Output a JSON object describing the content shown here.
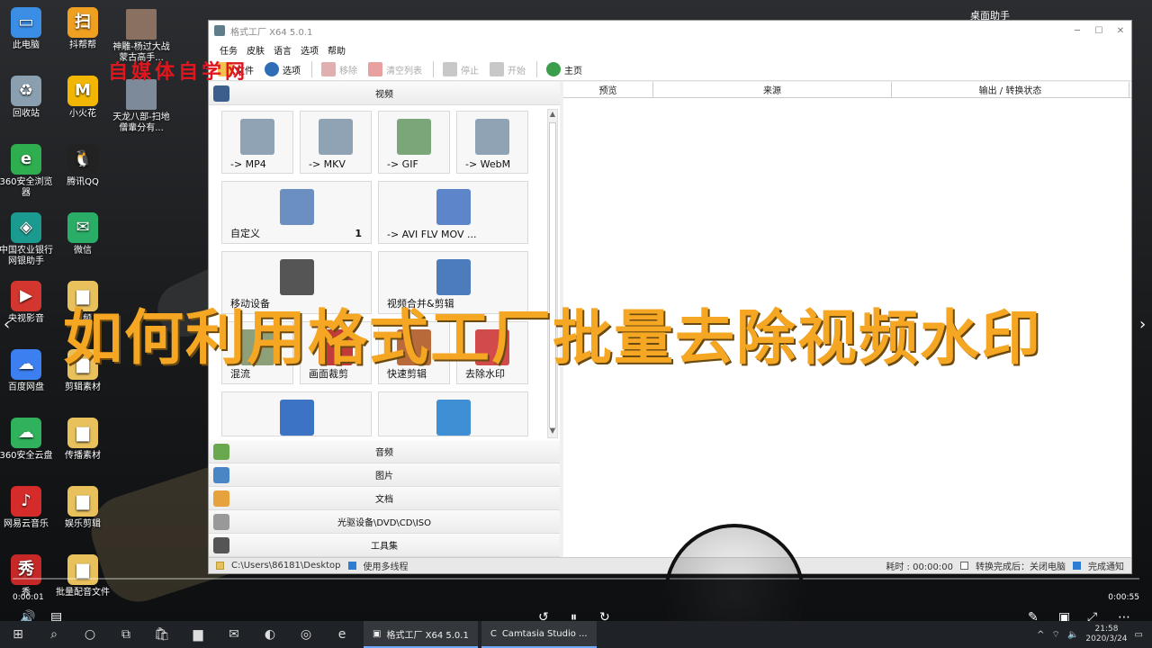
{
  "overlay_title": "如何利用格式工厂批量去除视频水印",
  "watermark_text": "自媒体自学网",
  "desktop_icons": [
    {
      "label": "此电脑",
      "color": "#3a8ee6",
      "glyph": "▭"
    },
    {
      "label": "回收站",
      "color": "#8aa0b0",
      "glyph": "♻"
    },
    {
      "label": "360安全浏览器",
      "color": "#2eae4f",
      "glyph": "e"
    },
    {
      "label": "中国农业银行网银助手",
      "color": "#1b9b8f",
      "glyph": "◈"
    },
    {
      "label": "央视影音",
      "color": "#d3362e",
      "glyph": "▶"
    },
    {
      "label": "百度网盘",
      "color": "#3b7ff0",
      "glyph": "☁"
    },
    {
      "label": "360安全云盘",
      "color": "#2fb25b",
      "glyph": "☁"
    },
    {
      "label": "网易云音乐",
      "color": "#d62b2b",
      "glyph": "♪"
    },
    {
      "label": "秀",
      "color": "#c62828",
      "glyph": "秀"
    }
  ],
  "desktop_icons_col2": [
    {
      "label": "抖帮帮",
      "color": "#f0a020",
      "glyph": "扫"
    },
    {
      "label": "小火花",
      "color": "#f2b705",
      "glyph": "M"
    },
    {
      "label": "腾讯QQ",
      "color": "#222",
      "glyph": "🐧"
    },
    {
      "label": "微信",
      "color": "#2aae67",
      "glyph": "✉"
    },
    {
      "label": "视频",
      "color": "#e8c15c",
      "glyph": "▆"
    },
    {
      "label": "剪辑素材",
      "color": "#e8c15c",
      "glyph": "▆"
    },
    {
      "label": "传播素材",
      "color": "#e8c15c",
      "glyph": "▆"
    },
    {
      "label": "娱乐剪辑",
      "color": "#e8c15c",
      "glyph": "▆"
    },
    {
      "label": "批量配音文件",
      "color": "#e8c15c",
      "glyph": "▆"
    }
  ],
  "desktop_files_col3": [
    {
      "label": "神雕-杨过大战蒙古高手..."
    },
    {
      "label": "天龙八部-扫地僧輩分有..."
    }
  ],
  "right_helper": "桌面助手",
  "window": {
    "title": "格式工厂 X64 5.0.1",
    "menu": [
      "任务",
      "皮肤",
      "语言",
      "选项",
      "帮助"
    ],
    "toolbar": [
      {
        "label": "文件",
        "enabled": true
      },
      {
        "label": "选项",
        "enabled": true
      },
      {
        "label": "移除",
        "enabled": false
      },
      {
        "label": "清空列表",
        "enabled": false
      },
      {
        "label": "停止",
        "enabled": false
      },
      {
        "label": "开始",
        "enabled": false
      },
      {
        "label": "主页",
        "enabled": true
      }
    ],
    "video_category": "视频",
    "tiles": [
      {
        "label": "-> MP4",
        "color": "#8fa3b5"
      },
      {
        "label": "-> MKV",
        "color": "#8fa3b5"
      },
      {
        "label": "-> GIF",
        "color": "#7aa67a"
      },
      {
        "label": "-> WebM",
        "color": "#8fa3b5"
      },
      {
        "label": "自定义",
        "badge": "1",
        "color": "#6c8fc2"
      },
      {
        "label": "-> AVI FLV MOV ...",
        "color": "#5c86c9"
      },
      {
        "label": "移动设备",
        "color": "#555"
      },
      {
        "label": "视频合并&剪辑",
        "color": "#4d7cbd"
      },
      {
        "label": "混流",
        "color": "#8da07a"
      },
      {
        "label": "画面裁剪",
        "color": "#c23b3b"
      },
      {
        "label": "快速剪辑",
        "color": "#b86a3a"
      },
      {
        "label": "去除水印",
        "color": "#d24b4b"
      },
      {
        "label": "",
        "color": "#3d73c4"
      },
      {
        "label": "",
        "color": "#3e8fd4"
      }
    ],
    "categories": [
      "音频",
      "图片",
      "文档",
      "光驱设备\\DVD\\CD\\ISO",
      "工具集"
    ],
    "columns": [
      "预览",
      "来源",
      "输出 / 转换状态"
    ],
    "status": {
      "path": "C:\\Users\\86181\\Desktop",
      "multithread": "使用多线程",
      "elapsed": "耗时 : 00:00:00",
      "after_done": "转换完成后：关闭电脑",
      "notify": "完成通知"
    }
  },
  "player": {
    "current": "0:00:01",
    "duration": "0:00:55"
  },
  "taskbar": {
    "apps": [
      "格式工厂 X64 5.0.1",
      "Camtasia Studio ..."
    ],
    "time": "21:58",
    "date": "2020/3/24"
  }
}
